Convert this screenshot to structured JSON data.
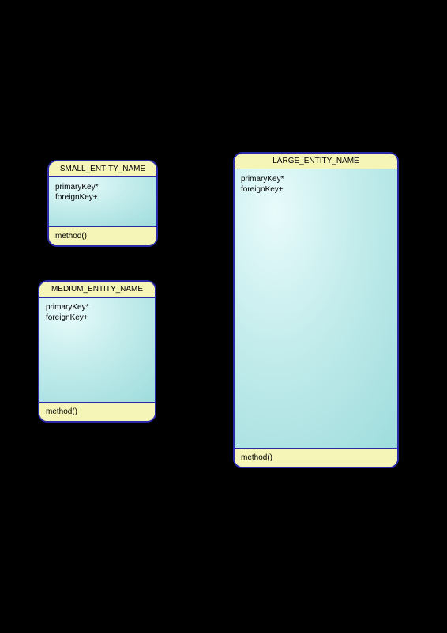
{
  "entities": {
    "small": {
      "title": "SMALL_ENTITY_NAME",
      "pk": "primaryKey*",
      "fk": "foreignKey+",
      "method": "method()"
    },
    "medium": {
      "title": "MEDIUM_ENTITY_NAME",
      "pk": "primaryKey*",
      "fk": "foreignKey+",
      "method": "method()"
    },
    "large": {
      "title": "LARGE_ENTITY_NAME",
      "pk": "primaryKey*",
      "fk": "foreignKey+",
      "method": "method()"
    }
  }
}
